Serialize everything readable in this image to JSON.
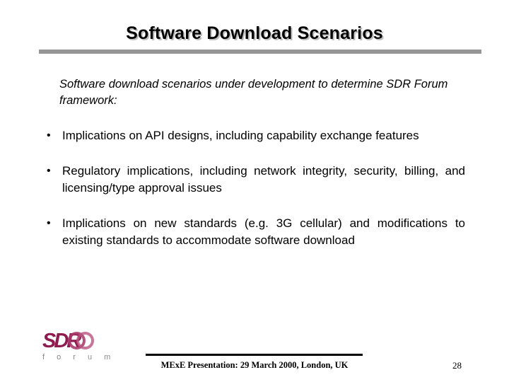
{
  "slide": {
    "title": "Software Download Scenarios",
    "intro": "Software download scenarios under development to determine SDR Forum framework:",
    "bullet_marker": "•",
    "bullets": [
      "Implications on API designs, including capability exchange features",
      "Regulatory implications, including network integrity, security, billing, and licensing/type approval issues",
      "Implications on new standards (e.g. 3G cellular) and modifications to existing standards to accommodate software download"
    ]
  },
  "footer": {
    "logo_primary": "SDR",
    "logo_secondary": "f o r u m",
    "caption": "MExE Presentation: 29 March 2000, London, UK",
    "page_number": "28"
  },
  "colors": {
    "title_text": "#000000",
    "title_shadow": "#c0c0c0",
    "title_rule": "#969696",
    "logo_maroon": "#8e1b4f",
    "logo_gray": "#8a8a8a",
    "footer_rule": "#000000",
    "background": "#ffffff"
  }
}
